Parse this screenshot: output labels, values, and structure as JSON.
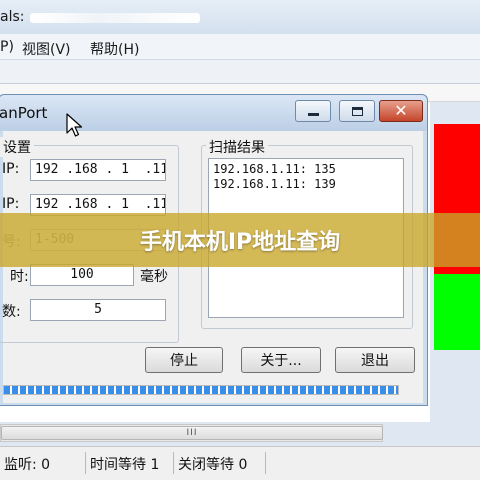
{
  "main_window": {
    "title_prefix": "als: ",
    "menu": [
      {
        "label": "P)"
      },
      {
        "label": "视图(V)"
      },
      {
        "label": "帮助(H)"
      }
    ],
    "status_panels": [
      {
        "color": "#ff0000"
      },
      {
        "color": "#ff0000"
      },
      {
        "color": "#00ff00"
      }
    ],
    "scrollbar_thumb": "III",
    "statusbar": [
      {
        "label": "监听: 0"
      },
      {
        "label": "时间等待 1"
      },
      {
        "label": "关闭等待 0"
      }
    ]
  },
  "dialog": {
    "title": "anPort",
    "settings_group": {
      "legend": "设置",
      "start_ip": {
        "label": "IP:",
        "value": "192 .168 . 1  .11"
      },
      "end_ip": {
        "label": "IP:",
        "value": "192 .168 . 1  .11"
      },
      "port": {
        "label": "号:",
        "value": "1-500"
      },
      "timeout": {
        "label": "时:",
        "value": "100",
        "unit": "毫秒"
      },
      "threads": {
        "label": "数:",
        "value": "5"
      }
    },
    "results_group": {
      "legend": "扫描结果",
      "rows": [
        {
          "text": "192.168.1.11: 135"
        },
        {
          "text": "192.168.1.11: 139"
        }
      ]
    },
    "buttons": {
      "stop": "停止",
      "about": "关于...",
      "exit": "退出"
    },
    "progress_fraction": 1.0
  },
  "overlay": {
    "caption": "手机本机IP地址查询"
  },
  "colors": {
    "red_panel": "#ff0000",
    "green_panel": "#00ff00",
    "caption_band": "#c8a528",
    "progress": "#3b8ee8"
  }
}
